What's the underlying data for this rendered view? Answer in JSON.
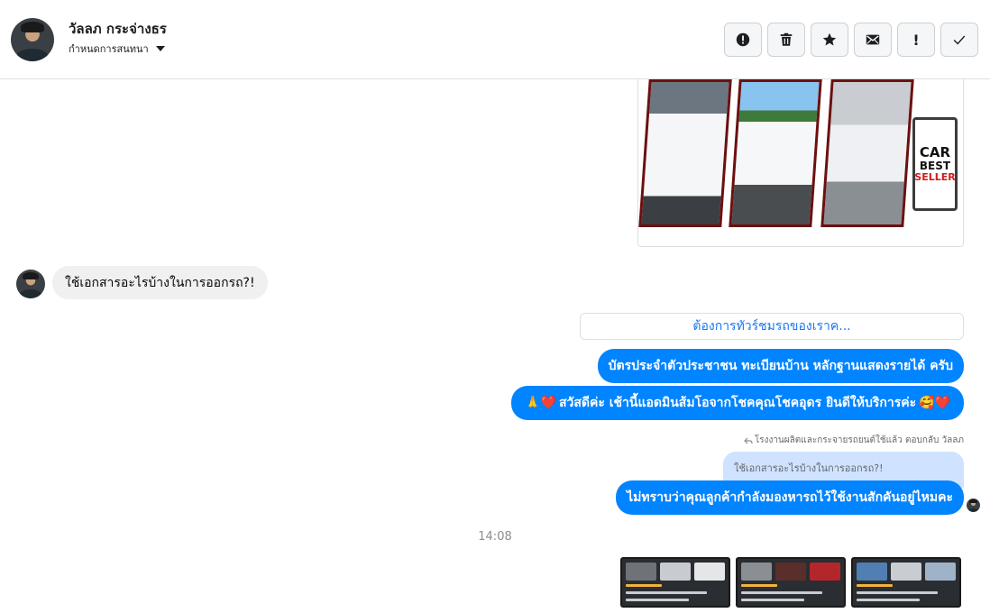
{
  "header": {
    "contact_name": "วัลลภ กระจ่างธร",
    "subtitle": "กำหนดการสนทนา",
    "toolbar": [
      {
        "name": "report-spam-button",
        "icon": "alert-circle-icon"
      },
      {
        "name": "delete-button",
        "icon": "trash-icon"
      },
      {
        "name": "star-button",
        "icon": "star-icon"
      },
      {
        "name": "mark-unread-button",
        "icon": "envelope-icon"
      },
      {
        "name": "follow-up-button",
        "icon": "exclamation-icon",
        "label": "!"
      },
      {
        "name": "done-button",
        "icon": "check-icon"
      }
    ]
  },
  "image_card": {
    "badge_line1": "CAR",
    "badge_line2": "BEST",
    "badge_line3": "SELLER"
  },
  "messages": {
    "incoming_1": "ใช้เอกสารอะไรบ้างในการออกรถ?!",
    "quick_reply": "ต้องการทัวร์ชมรถของเราค...",
    "outgoing_1": "บัตรประจำตัวประชาชน ทะเบียนบ้าน หลักฐานแสดงรายได้ ครับ",
    "outgoing_2_prefix": "🙏❤️",
    "outgoing_2": "สวัสดีค่ะ เช้านี้แอดมินส้มโอจากโชคคุณโชคอุดร ยินดีให้บริการค่ะ",
    "outgoing_2_suffix": "🥰❤️",
    "reply_meta": "โรงงานผลิตและกระจายรถยนต์ใช้แล้ว ตอบกลับ วัลลภ",
    "quoted_text": "ใช้เอกสารอะไรบ้างในการออกรถ?!",
    "outgoing_3": "ไม่ทราบว่าคุณลูกค้ากำลังมองหารถไว้ใช้งานสักคันอยู่ไหมคะ",
    "timestamp": "14:08"
  },
  "colors": {
    "outgoing_bubble": "#0084ff",
    "incoming_bubble": "#f0f0f0",
    "quick_reply_text": "#1877f2",
    "quoted_bg": "#cfe2ff"
  }
}
